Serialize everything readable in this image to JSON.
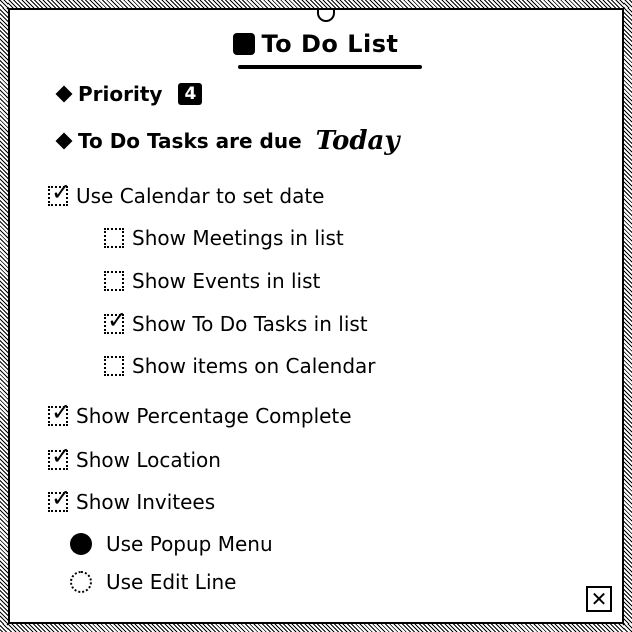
{
  "title": "To Do List",
  "priority": {
    "label": "Priority",
    "value": "4"
  },
  "due": {
    "label": "To Do Tasks are due",
    "value": "Today"
  },
  "options": [
    {
      "label": "Use Calendar to set date",
      "checked": true,
      "indent": 0
    },
    {
      "label": "Show Meetings in list",
      "checked": false,
      "indent": 1
    },
    {
      "label": "Show Events in list",
      "checked": false,
      "indent": 1
    },
    {
      "label": "Show To Do Tasks in list",
      "checked": true,
      "indent": 1
    },
    {
      "label": "Show items on Calendar",
      "checked": false,
      "indent": 1
    },
    {
      "label": "Show Percentage Complete",
      "checked": true,
      "indent": 0
    },
    {
      "label": "Show Location",
      "checked": true,
      "indent": 0
    },
    {
      "label": "Show Invitees",
      "checked": true,
      "indent": 0
    }
  ],
  "radios": [
    {
      "label": "Use Popup Menu",
      "selected": true
    },
    {
      "label": "Use Edit Line",
      "selected": false
    }
  ],
  "close_icon": "close-box-icon"
}
